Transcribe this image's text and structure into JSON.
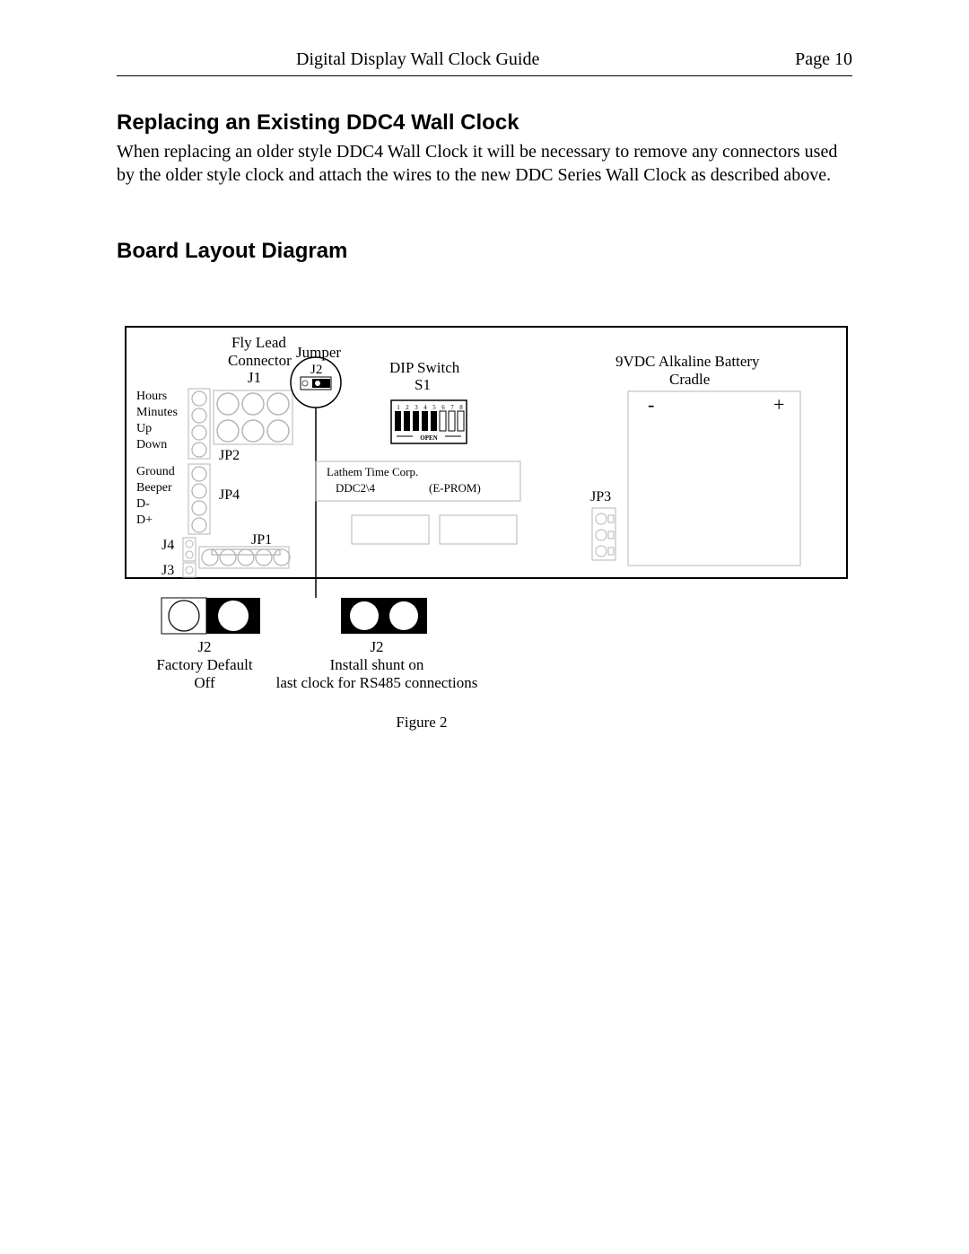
{
  "header": {
    "title": "Digital Display Wall Clock Guide",
    "page": "Page 10"
  },
  "section1": {
    "heading": "Replacing an Existing DDC4 Wall Clock",
    "body": "When replacing an older style DDC4 Wall Clock it will be necessary to remove any connectors used by the older style clock and attach the wires to the new DDC Series Wall Clock as described above."
  },
  "section2": {
    "heading": "Board Layout Diagram"
  },
  "diagram": {
    "sideLabels": [
      "Hours",
      "Minutes",
      "Up",
      "Down",
      "Ground",
      "Beeper",
      "D-",
      "D+"
    ],
    "flyLead": "Fly Lead",
    "connector": "Connector",
    "j1": "J1",
    "jumper": "Jumper",
    "j2": "J2",
    "dipSwitchTitle": "DIP Switch",
    "s1": "S1",
    "dipNums": [
      "1",
      "2",
      "3",
      "4",
      "5",
      "6",
      "7",
      "8"
    ],
    "open": "OPEN",
    "chipLine1": "Lathem Time Corp.",
    "chipLine2a": "DDC2\\4",
    "chipLine2b": "(E-PROM)",
    "batteryTitle": "9VDC Alkaline Battery",
    "cradle": "Cradle",
    "minus": "-",
    "plus": "+",
    "jp1": "JP1",
    "jp2": "JP2",
    "jp3": "JP3",
    "jp4": "JP4",
    "j3": "J3",
    "j4": "J4",
    "j2Default1": "J2",
    "j2Default2": "Factory Default",
    "j2Default3": "Off",
    "j2Install1": "J2",
    "j2Install2": "Install shunt on",
    "j2Install3": "last clock for RS485 connections",
    "figure": "Figure 2"
  }
}
